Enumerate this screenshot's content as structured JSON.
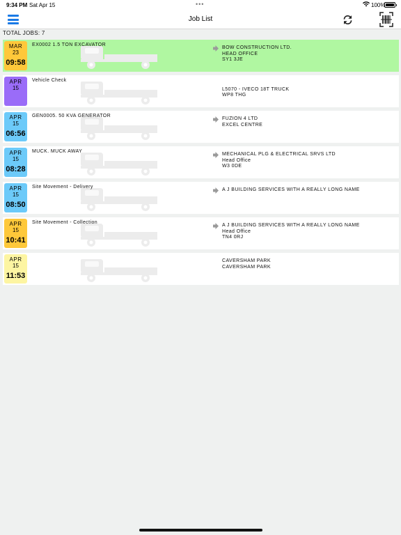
{
  "status": {
    "time": "9:34 PM",
    "date": "Sat Apr 15",
    "battery": "100%",
    "dots": "•••"
  },
  "nav": {
    "title": "Job List"
  },
  "summary": {
    "total": "TOTAL JOBS: 7"
  },
  "colors": {
    "accent": "#1a7ae6",
    "selected_row": "#b0f7a1"
  },
  "jobs": [
    {
      "month": "MAR",
      "day": "23",
      "time": "09:58",
      "badge_color": "#fec83a",
      "description": "EX0002 1.5 TON EXCAVATOR",
      "address": [
        "BOW CONSTRUCTION LTD.",
        "HEAD OFFICE",
        "SY1 3JE"
      ],
      "selected": true,
      "has_arrow": true
    },
    {
      "month": "APR",
      "day": "15",
      "time": "",
      "badge_color": "#9a6cf8",
      "description": "Vehicle Check",
      "address": [
        "",
        "L5070 - IVECO 18T TRUCK",
        "WP8 THG"
      ],
      "selected": false,
      "has_arrow": false
    },
    {
      "month": "APR",
      "day": "15",
      "time": "06:56",
      "badge_color": "#6ccaf9",
      "description": "GEN0005. 50 KVA GENERATOR",
      "address": [
        "FUZION 4 LTD",
        "EXCEL CENTRE"
      ],
      "selected": false,
      "has_arrow": true
    },
    {
      "month": "APR",
      "day": "15",
      "time": "08:28",
      "badge_color": "#6ccaf9",
      "description": "MUCK. MUCK AWAY",
      "address": [
        "MECHANICAL PLG & ELECTRICAL SRVS LTD",
        "Head Office",
        "W3 0DE"
      ],
      "selected": false,
      "has_arrow": true
    },
    {
      "month": "APR",
      "day": "15",
      "time": "08:50",
      "badge_color": "#6ccaf9",
      "description": "Site Movement - Delivery",
      "address": [
        "A J BUILDING SERVICES WITH A REALLY LONG NAME"
      ],
      "selected": false,
      "has_arrow": true
    },
    {
      "month": "APR",
      "day": "15",
      "time": "10:41",
      "badge_color": "#fec83a",
      "description": "Site Movement - Collection",
      "address": [
        "A J BUILDING SERVICES WITH A REALLY LONG NAME",
        "Head Office",
        "TN4 0RJ"
      ],
      "selected": false,
      "has_arrow": true
    },
    {
      "month": "APR",
      "day": "15",
      "time": "11:53",
      "badge_color": "#fdf5a2",
      "description": "",
      "address": [
        "CAVERSHAM PARK",
        "CAVERSHAM PARK"
      ],
      "selected": false,
      "has_arrow": false
    }
  ],
  "icons": {
    "menu": "hamburger-icon",
    "refresh": "refresh-icon",
    "scan": "barcode-scan-icon",
    "arrow": "arrow-right-icon",
    "truck": "truck-icon"
  }
}
